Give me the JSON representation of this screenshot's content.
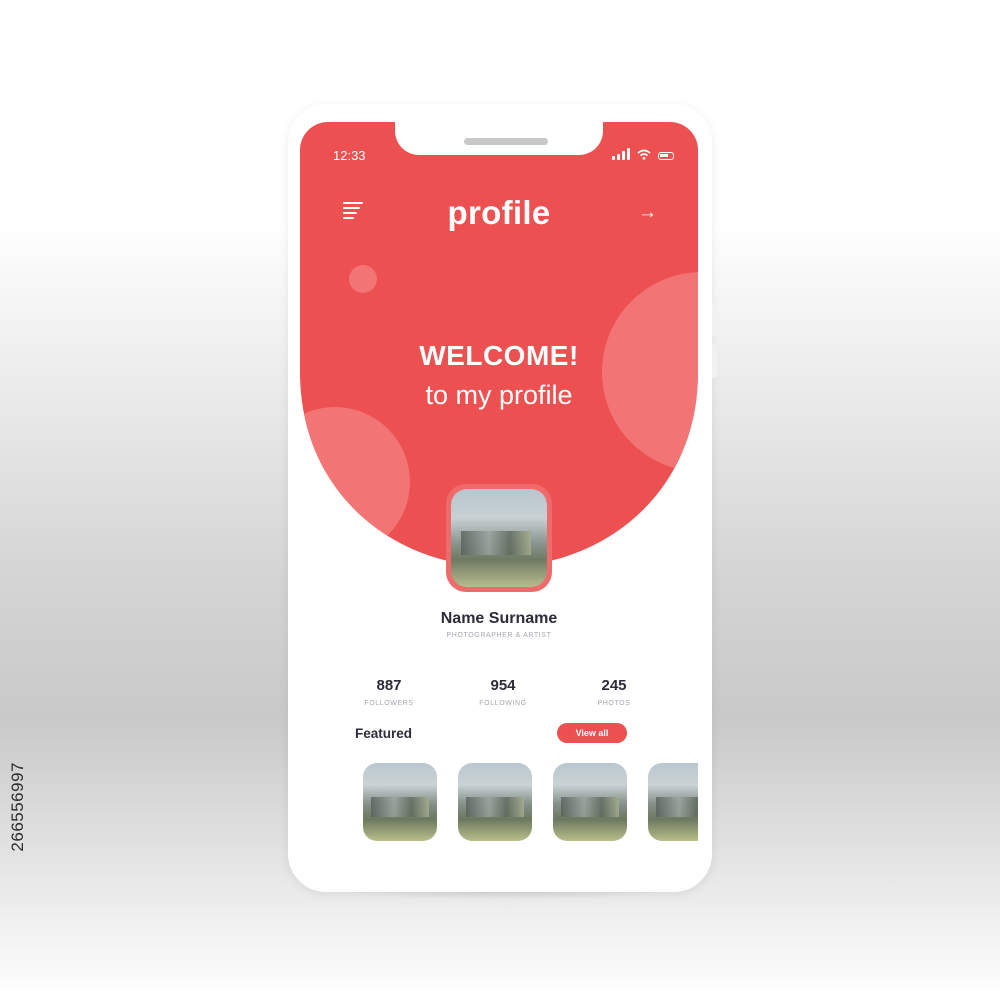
{
  "side_id": "266556997",
  "status_bar": {
    "time": "12:33",
    "icons": [
      "signal-bars-icon",
      "wifi-icon",
      "battery-icon"
    ]
  },
  "header": {
    "menu_icon": "menu-icon",
    "title": "profile",
    "action_icon": "arrow-right-icon",
    "action_glyph": "→"
  },
  "hero": {
    "welcome": "WELCOME!",
    "subtitle": "to my profile"
  },
  "profile": {
    "name": "Name Surname",
    "role": "PHOTOGRAPHER & ARTIST"
  },
  "stats": [
    {
      "value": "887",
      "label": "FOLLOWERS"
    },
    {
      "value": "954",
      "label": "FOLLOWING"
    },
    {
      "value": "245",
      "label": "PHOTOS"
    }
  ],
  "featured": {
    "heading": "Featured",
    "view_all_label": "View all",
    "thumb_count": 4
  },
  "colors": {
    "accent": "#ec5050",
    "accent_light": "#f27474",
    "text_dark": "#2c2c3a",
    "text_muted": "#a6a6b0"
  }
}
